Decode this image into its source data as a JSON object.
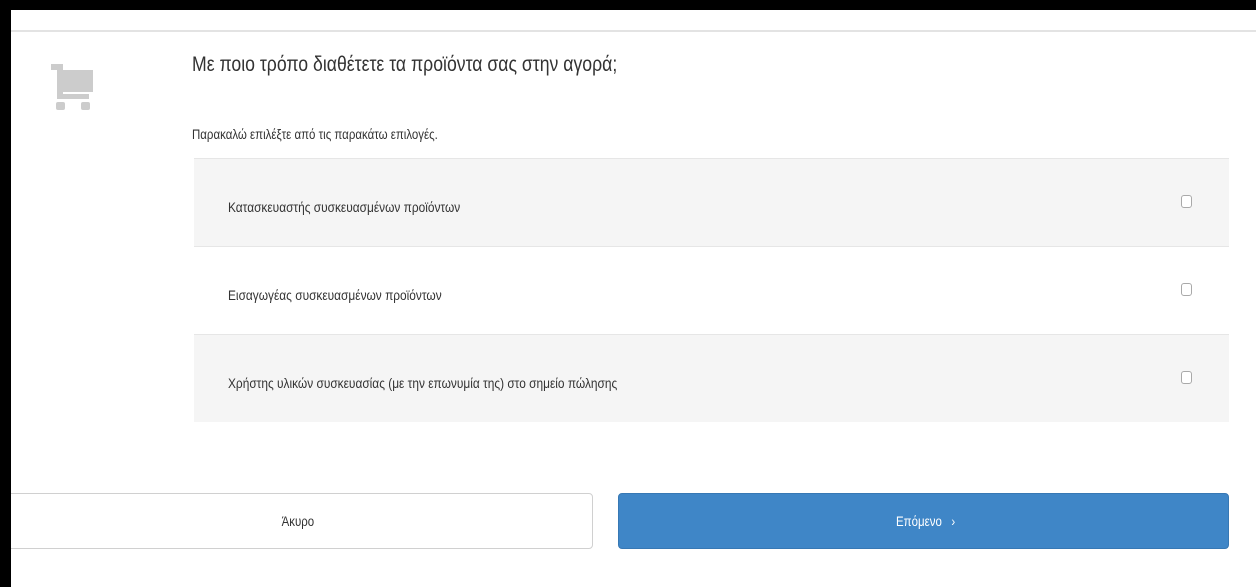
{
  "question": {
    "title": "Με ποιο τρόπο διαθέτετε τα προϊόντα σας στην αγορά;",
    "instruction": "Παρακαλώ επιλέξτε από τις παρακάτω επιλογές.",
    "icon": "shopping-cart-icon"
  },
  "options": [
    {
      "label": "Κατασκευαστής συσκευασμένων προϊόντων",
      "checked": false
    },
    {
      "label": "Εισαγωγέας συσκευασμένων προϊόντων",
      "checked": false
    },
    {
      "label": "Χρήστης υλικών συσκευασίας (με την επωνυμία της) στο σημείο πώλησης",
      "checked": false
    }
  ],
  "buttons": {
    "cancel_label": "Άκυρο",
    "next_label": "Επόμενο",
    "next_icon": "chevron-right-icon"
  },
  "colors": {
    "primary": "#3f86c7",
    "icon_gray": "#cccccc",
    "option_bg": "#f5f5f5"
  }
}
